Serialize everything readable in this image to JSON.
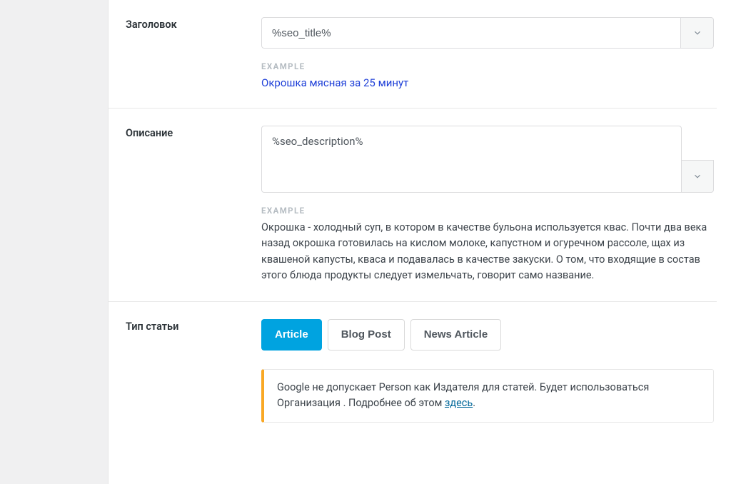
{
  "colors": {
    "accent": "#00a3e0",
    "warning": "#f9a825",
    "link": "#1e3fd8"
  },
  "title_row": {
    "label": "Заголовок",
    "value": "%seo_title%",
    "example_heading": "EXAMPLE",
    "example_value": "Окрошка мясная за 25 минут"
  },
  "description_row": {
    "label": "Описание",
    "value": "%seo_description%",
    "example_heading": "EXAMPLE",
    "example_value": "Окрошка - холодный суп, в котором в качестве бульона используется квас. Почти два века назад окрошка готовилась на кислом молоке, капустном и огуречном рассоле, щах из квашеной капусты, кваса и подавалась в качестве закуски. О том, что входящие в состав этого блюда продукты следует измельчать, говорит само название."
  },
  "article_type_row": {
    "label": "Тип статьи",
    "options": [
      {
        "label": "Article",
        "active": true
      },
      {
        "label": "Blog Post",
        "active": false
      },
      {
        "label": "News Article",
        "active": false
      }
    ],
    "notice_pre": "Google не допускает Person как Издателя для статей. Будет использоваться Организация . Подробнее об этом ",
    "notice_link": "здесь",
    "notice_post": "."
  }
}
